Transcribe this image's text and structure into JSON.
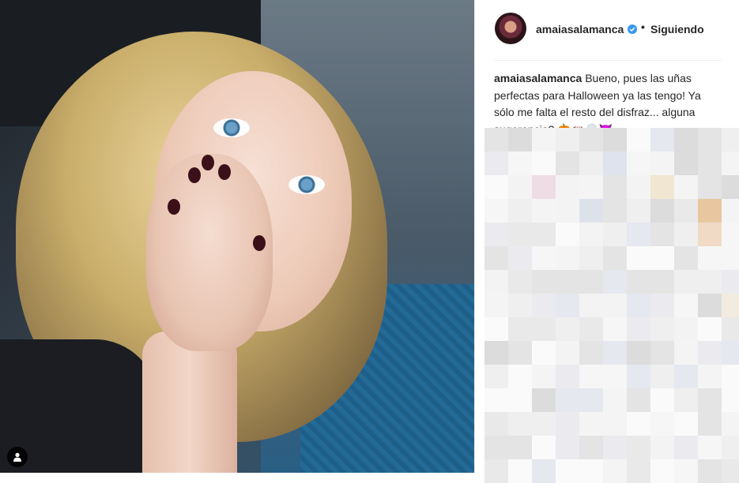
{
  "post": {
    "username": "amaiasalamanca",
    "separator": "•",
    "follow_status": "Siguiendo",
    "caption_username": "amaiasalamanca",
    "caption_text": "Bueno, pues las uñas perfectas para Halloween ya las tengo! Ya sólo me falta el resto del disfraz... alguna sugerencia? 🎃🦇💀😈"
  },
  "icons": {
    "verified": "verified-badge-icon",
    "tagged_user": "tagged-user-icon"
  },
  "colors": {
    "text": "#262626",
    "verified_blue": "#3897f0",
    "divider": "#efefef"
  }
}
